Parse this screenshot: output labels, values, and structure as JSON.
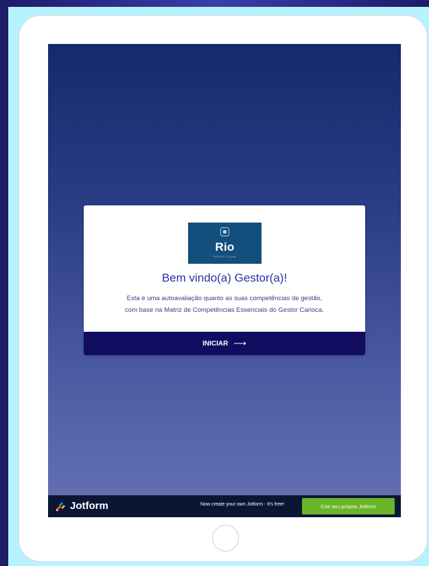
{
  "card": {
    "logo_text": "Rio",
    "logo_subtext": "PREFEITURA",
    "title": "Bem vindo(a) Gestor(a)!",
    "description_line1": "Esta é uma autoavaliação quanto as suas competências de gestão,",
    "description_line2": "com base na Matriz de Competências Essenciais do Gestor Carioca.",
    "start_button_label": "INICIAR",
    "start_button_arrow": "⟶"
  },
  "jotform_bar": {
    "brand": "Jotform",
    "note": "Now create your own Jotform - It's free!",
    "cta_label": "Crie seu próprio Jotform"
  },
  "colors": {
    "screen_gradient_top": "#142a6c",
    "screen_gradient_bottom": "#6672b3",
    "title": "#2b2fa3",
    "start_button": "#100c60",
    "logo_bg": "#124f7c",
    "cta_green": "#6ab52a",
    "jotform_bar": "#0b1634",
    "page_frame": "#b6f3ff"
  },
  "icons": {
    "logo_emblem": "rio-emblem-icon",
    "start_arrow": "arrow-right-icon",
    "jotform_logo": "jotform-logo-icon",
    "home": "home-button-icon"
  }
}
